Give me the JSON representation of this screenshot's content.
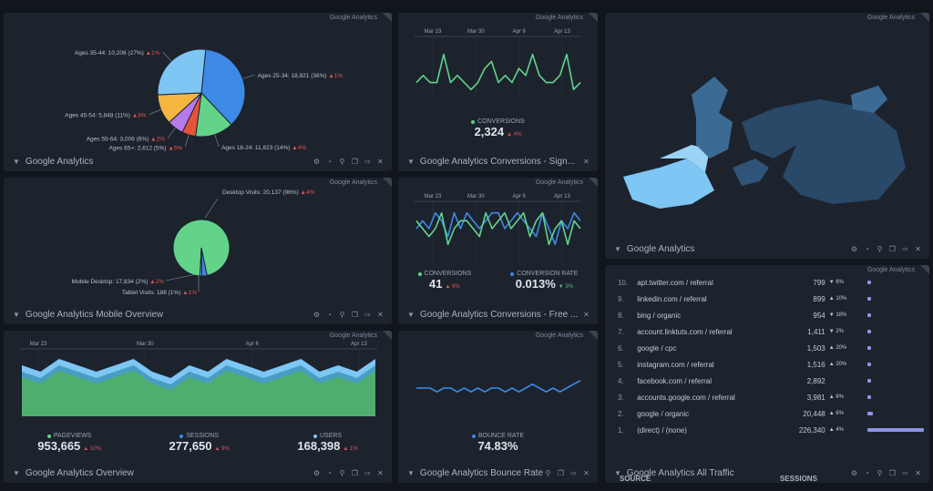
{
  "brand": "Google Analytics",
  "colors": {
    "bg": "#11161d",
    "panel": "#1c232d",
    "green": "#63d38a",
    "blue": "#3d8ae6",
    "light_blue": "#7ec6f4",
    "purple": "#8c94e6",
    "red": "#e05555"
  },
  "tools": [
    "gear-icon",
    "bell-icon",
    "pin-icon",
    "copy-icon",
    "share-icon",
    "close-icon"
  ],
  "panels": {
    "age": {
      "title": "Google Analytics",
      "slices": [
        {
          "label": "Ages 25-34: 18,821 (36%)",
          "chg": "1%",
          "value": 36,
          "color": "#3d8ae6"
        },
        {
          "label": "Ages 18-24: 11,823 (14%)",
          "chg": "4%",
          "value": 14,
          "color": "#63d38a"
        },
        {
          "label": "Ages 65+: 2,612 (5%)",
          "chg": "5%",
          "value": 5,
          "color": "#e5543a"
        },
        {
          "label": "Ages 55-64: 3,006 (6%)",
          "chg": "2%",
          "value": 6,
          "color": "#b57be8"
        },
        {
          "label": "Ages 45-54: 5,848 (11%)",
          "chg": "8%",
          "value": 11,
          "color": "#f5b640"
        },
        {
          "label": "Ages 35-44: 10,206 (27%)",
          "chg": "1%",
          "value": 27,
          "color": "#7ec6f4"
        }
      ]
    },
    "conv_sign": {
      "title": "Google Analytics Conversions - Sign...",
      "dates": [
        "Mar 23",
        "Mar 30",
        "Apr 6",
        "Apr 13"
      ],
      "series_name": "CONVERSIONS",
      "values": [
        5,
        6,
        5,
        5,
        9,
        5,
        6,
        5,
        4,
        5,
        7,
        8,
        5,
        6,
        5,
        7,
        6,
        9,
        6,
        5,
        5,
        6,
        9,
        4,
        5
      ],
      "total": "2,324",
      "chg": "4%"
    },
    "world": {
      "title": "Google Analytics"
    },
    "device": {
      "title": "Google Analytics Mobile Overview",
      "labels": [
        {
          "text": "Desktop Visits: 20,137 (96%)",
          "chg": "4%"
        },
        {
          "text": "Mobile Desktop: 17,834 (2%)",
          "chg": "2%"
        },
        {
          "text": "Tablet Visits: 188 (1%)",
          "chg": "1%"
        }
      ],
      "slices": [
        {
          "value": 96,
          "color": "#63d38a"
        },
        {
          "value": 3,
          "color": "#3d8ae6"
        },
        {
          "value": 1,
          "color": "#7ec6f4"
        }
      ]
    },
    "conv_free": {
      "title": "Google Analytics Conversions - Free ...",
      "dates": [
        "Mar 23",
        "Mar 30",
        "Apr 6",
        "Apr 13"
      ],
      "series_a": {
        "name": "CONVERSIONS",
        "values": [
          4,
          3,
          2,
          3,
          5,
          1,
          3,
          4,
          4,
          3,
          2,
          5,
          3,
          4,
          5,
          3,
          4,
          5,
          2,
          4,
          5,
          1,
          3,
          4,
          1,
          4,
          3
        ]
      },
      "series_b": {
        "name": "CONVERSION RATE",
        "values": [
          3,
          4,
          3,
          5,
          4,
          2,
          5,
          3,
          5,
          4,
          3,
          4,
          5,
          5,
          3,
          4,
          5,
          4,
          3,
          2,
          5,
          3,
          1,
          4,
          3,
          5,
          4
        ]
      },
      "total_a": "41",
      "chg_a": "6%",
      "total_b": "0.013%",
      "chg_b": "3%"
    },
    "overview": {
      "title": "Google Analytics Overview",
      "dates": [
        "Mar 23",
        "Mar 30",
        "Apr 6",
        "Apr 13"
      ],
      "stats": [
        {
          "name": "PAGEVIEWS",
          "value": "953,665",
          "chg": "10%",
          "color": "#63d38a"
        },
        {
          "name": "SESSIONS",
          "value": "277,650",
          "chg": "9%",
          "color": "#3d8ae6"
        },
        {
          "name": "USERS",
          "value": "168,398",
          "chg": "1%",
          "color": "#7ec6f4"
        }
      ],
      "area_top": [
        8,
        7,
        9,
        8,
        7,
        8,
        9,
        7,
        6,
        8,
        7,
        9,
        8,
        7,
        8,
        9,
        7,
        8,
        7,
        9
      ],
      "area_green": [
        7,
        5,
        4,
        7,
        6,
        5,
        3,
        6,
        5,
        3,
        4,
        6,
        5,
        3,
        4,
        5,
        6,
        3,
        4,
        6
      ]
    },
    "bounce": {
      "title": "Google Analytics Bounce Rate",
      "series_name": "BOUNCE RATE",
      "total": "74.83%",
      "values": [
        6,
        6,
        6,
        5,
        6,
        6,
        5,
        6,
        5,
        6,
        5,
        6,
        6,
        5,
        6,
        5,
        6,
        7,
        6,
        5,
        6,
        5,
        6,
        7,
        8
      ]
    },
    "traffic": {
      "title": "Google Analytics All Traffic",
      "col_source": "SOURCE",
      "col_sessions": "SESSIONS",
      "rows": [
        {
          "n": "10.",
          "src": "apt.twitter.com / referral",
          "ses": "799",
          "chg": "6%",
          "dir": "up",
          "pct": 2
        },
        {
          "n": "9.",
          "src": "linkedin.com / referral",
          "ses": "899",
          "chg": "10%",
          "dir": "down",
          "pct": 2
        },
        {
          "n": "8.",
          "src": "bing / organic",
          "ses": "954",
          "chg": "18%",
          "dir": "up",
          "pct": 2
        },
        {
          "n": "7.",
          "src": "account.linktuts.com / referral",
          "ses": "1,411",
          "chg": "2%",
          "dir": "up",
          "pct": 3
        },
        {
          "n": "6.",
          "src": "google / cpc",
          "ses": "1,503",
          "chg": "20%",
          "dir": "down",
          "pct": 3
        },
        {
          "n": "5.",
          "src": "instagram.com / referral",
          "ses": "1,516",
          "chg": "20%",
          "dir": "down",
          "pct": 3
        },
        {
          "n": "4.",
          "src": "facebook.com / referral",
          "ses": "2,892",
          "chg": "",
          "dir": "up",
          "pct": 4
        },
        {
          "n": "3.",
          "src": "accounts.google.com / referral",
          "ses": "3,981",
          "chg": "6%",
          "dir": "down",
          "pct": 5
        },
        {
          "n": "2.",
          "src": "google / organic",
          "ses": "20,448",
          "chg": "6%",
          "dir": "down",
          "pct": 9
        },
        {
          "n": "1.",
          "src": "(direct) / (none)",
          "ses": "226,340",
          "chg": "4%",
          "dir": "down",
          "pct": 100
        }
      ]
    }
  }
}
